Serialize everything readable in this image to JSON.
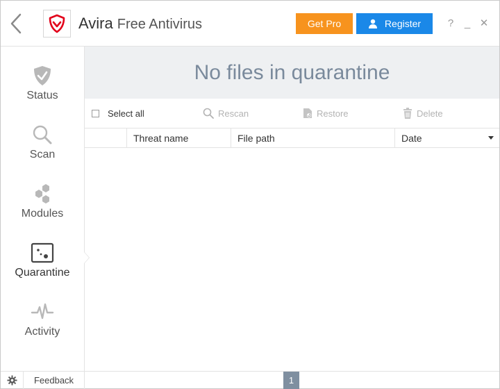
{
  "header": {
    "brand": "Avira",
    "product": "Free Antivirus",
    "get_pro_label": "Get Pro",
    "register_label": "Register",
    "help_label": "?",
    "minimize_label": "_",
    "close_label": "✕"
  },
  "sidebar": {
    "items": [
      {
        "label": "Status",
        "icon": "shield-check-icon"
      },
      {
        "label": "Scan",
        "icon": "magnifier-icon"
      },
      {
        "label": "Modules",
        "icon": "hexagons-icon"
      },
      {
        "label": "Quarantine",
        "icon": "quarantine-box-icon",
        "active": true
      },
      {
        "label": "Activity",
        "icon": "pulse-icon"
      }
    ]
  },
  "main": {
    "banner_text": "No files in quarantine",
    "toolbar": {
      "select_all": "Select all",
      "rescan": "Rescan",
      "restore": "Restore",
      "delete": "Delete"
    },
    "table": {
      "columns": [
        "",
        "Threat name",
        "File path",
        "Date"
      ],
      "rows": []
    }
  },
  "statusbar": {
    "feedback_label": "Feedback",
    "page_number": "1"
  },
  "colors": {
    "accent_orange": "#f7931e",
    "accent_blue": "#1a88e8",
    "banner_bg": "#eef0f2",
    "banner_text": "#7a8a9c",
    "brand_red": "#e2001a",
    "page_badge": "#7f8fa0"
  }
}
